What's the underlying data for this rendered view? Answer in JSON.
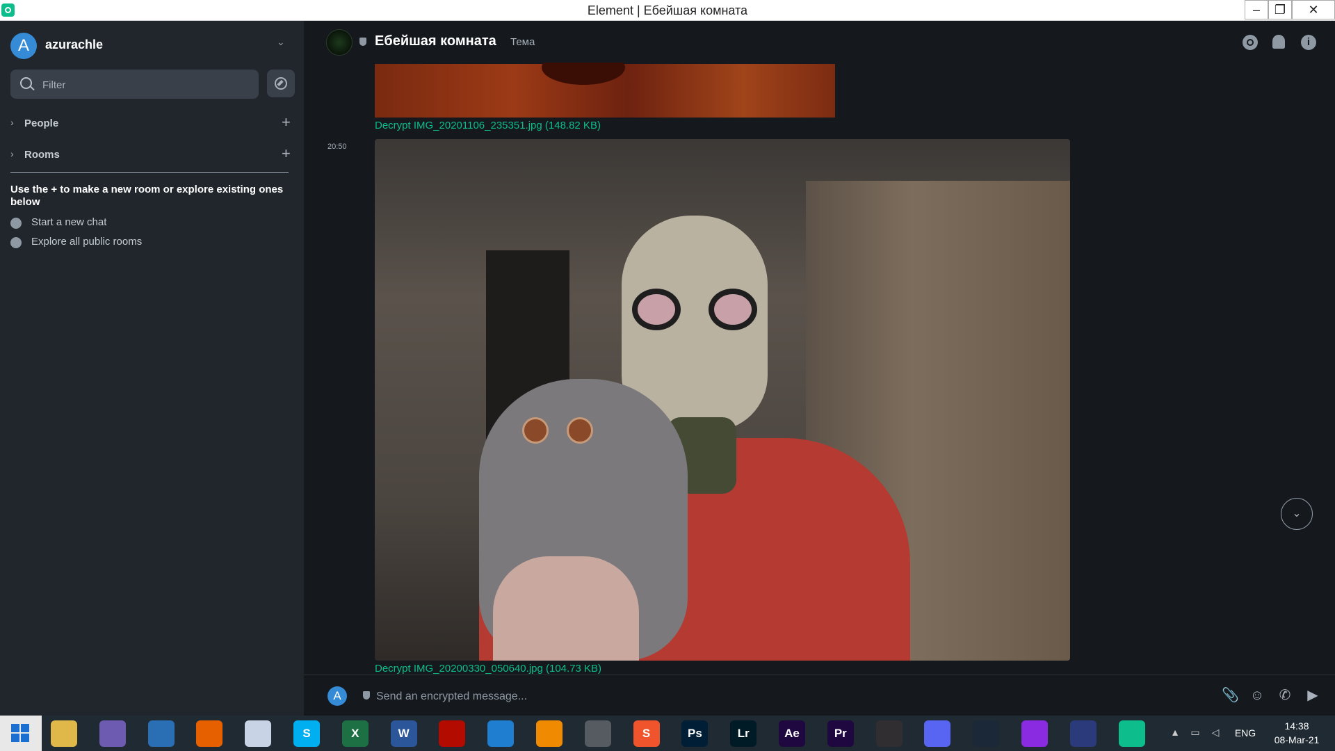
{
  "window": {
    "title": "Element | Ебейшая комната",
    "min_glyph": "–",
    "max_glyph": "❐",
    "close_glyph": "✕"
  },
  "sidebar": {
    "avatar_letter": "A",
    "username": "azurachle",
    "filter_placeholder": "Filter",
    "sections": [
      {
        "label": "People"
      },
      {
        "label": "Rooms"
      }
    ],
    "hint": "Use the + to make a new room or explore existing ones below",
    "links": [
      {
        "label": "Start a new chat"
      },
      {
        "label": "Explore all public rooms"
      }
    ]
  },
  "room": {
    "name": "Ебейшая комната",
    "topic": "Тема"
  },
  "timeline": {
    "file1": "Decrypt IMG_20201106_235351.jpg (148.82 KB)",
    "timestamp": "20:50",
    "file2": "Decrypt IMG_20200330_050640.jpg (104.73 KB)"
  },
  "composer": {
    "avatar_letter": "A",
    "placeholder": "Send an encrypted message..."
  },
  "taskbar": {
    "apps": [
      {
        "name": "file-explorer",
        "label": "",
        "color": "#e0b84a"
      },
      {
        "name": "bittorrent",
        "label": "",
        "color": "#6c5bb0"
      },
      {
        "name": "browser-globe",
        "label": "",
        "color": "#2a6fb4"
      },
      {
        "name": "firefox",
        "label": "",
        "color": "#e66000"
      },
      {
        "name": "moon-app",
        "label": "",
        "color": "#c8d4e6"
      },
      {
        "name": "skype",
        "label": "S",
        "color": "#00aff0"
      },
      {
        "name": "excel",
        "label": "X",
        "color": "#1d7044"
      },
      {
        "name": "word",
        "label": "W",
        "color": "#2b579a"
      },
      {
        "name": "acrobat",
        "label": "",
        "color": "#b30b00"
      },
      {
        "name": "vscode",
        "label": "",
        "color": "#1f7ed0"
      },
      {
        "name": "vlc",
        "label": "",
        "color": "#f08a00"
      },
      {
        "name": "downloader",
        "label": "",
        "color": "#555b61"
      },
      {
        "name": "s-app",
        "label": "S",
        "color": "#f0542d"
      },
      {
        "name": "photoshop",
        "label": "Ps",
        "color": "#001e36"
      },
      {
        "name": "lightroom",
        "label": "Lr",
        "color": "#001a26"
      },
      {
        "name": "after-effects",
        "label": "Ae",
        "color": "#1f0740"
      },
      {
        "name": "premiere",
        "label": "Pr",
        "color": "#1f0740"
      },
      {
        "name": "obs",
        "label": "",
        "color": "#302e31"
      },
      {
        "name": "discord",
        "label": "",
        "color": "#5865f2"
      },
      {
        "name": "steam",
        "label": "",
        "color": "#1b2838"
      },
      {
        "name": "ring-app",
        "label": "",
        "color": "#8a2be2"
      },
      {
        "name": "vpn-lock",
        "label": "",
        "color": "#2a3a7a"
      },
      {
        "name": "element",
        "label": "",
        "color": "#0dbd8b"
      }
    ],
    "lang": "ENG",
    "time": "14:38",
    "date": "08-Mar-21"
  }
}
